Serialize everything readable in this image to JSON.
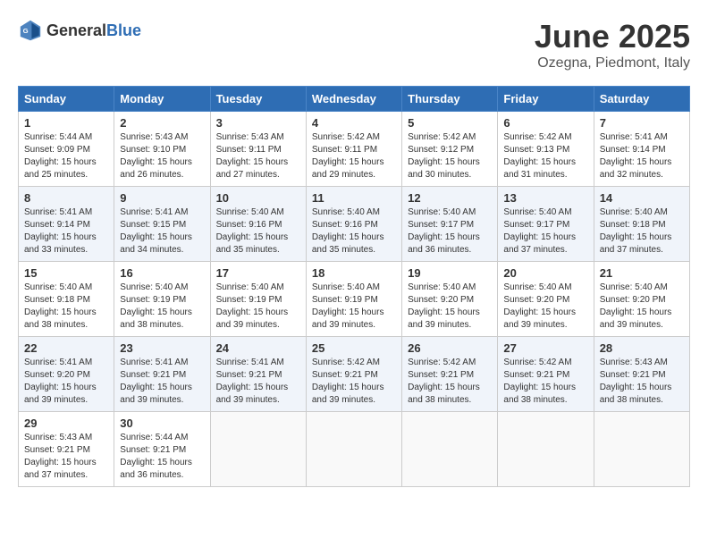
{
  "header": {
    "logo_general": "General",
    "logo_blue": "Blue",
    "month": "June 2025",
    "location": "Ozegna, Piedmont, Italy"
  },
  "days_of_week": [
    "Sunday",
    "Monday",
    "Tuesday",
    "Wednesday",
    "Thursday",
    "Friday",
    "Saturday"
  ],
  "weeks": [
    [
      {
        "day": "1",
        "info": "Sunrise: 5:44 AM\nSunset: 9:09 PM\nDaylight: 15 hours\nand 25 minutes."
      },
      {
        "day": "2",
        "info": "Sunrise: 5:43 AM\nSunset: 9:10 PM\nDaylight: 15 hours\nand 26 minutes."
      },
      {
        "day": "3",
        "info": "Sunrise: 5:43 AM\nSunset: 9:11 PM\nDaylight: 15 hours\nand 27 minutes."
      },
      {
        "day": "4",
        "info": "Sunrise: 5:42 AM\nSunset: 9:11 PM\nDaylight: 15 hours\nand 29 minutes."
      },
      {
        "day": "5",
        "info": "Sunrise: 5:42 AM\nSunset: 9:12 PM\nDaylight: 15 hours\nand 30 minutes."
      },
      {
        "day": "6",
        "info": "Sunrise: 5:42 AM\nSunset: 9:13 PM\nDaylight: 15 hours\nand 31 minutes."
      },
      {
        "day": "7",
        "info": "Sunrise: 5:41 AM\nSunset: 9:14 PM\nDaylight: 15 hours\nand 32 minutes."
      }
    ],
    [
      {
        "day": "8",
        "info": "Sunrise: 5:41 AM\nSunset: 9:14 PM\nDaylight: 15 hours\nand 33 minutes."
      },
      {
        "day": "9",
        "info": "Sunrise: 5:41 AM\nSunset: 9:15 PM\nDaylight: 15 hours\nand 34 minutes."
      },
      {
        "day": "10",
        "info": "Sunrise: 5:40 AM\nSunset: 9:16 PM\nDaylight: 15 hours\nand 35 minutes."
      },
      {
        "day": "11",
        "info": "Sunrise: 5:40 AM\nSunset: 9:16 PM\nDaylight: 15 hours\nand 35 minutes."
      },
      {
        "day": "12",
        "info": "Sunrise: 5:40 AM\nSunset: 9:17 PM\nDaylight: 15 hours\nand 36 minutes."
      },
      {
        "day": "13",
        "info": "Sunrise: 5:40 AM\nSunset: 9:17 PM\nDaylight: 15 hours\nand 37 minutes."
      },
      {
        "day": "14",
        "info": "Sunrise: 5:40 AM\nSunset: 9:18 PM\nDaylight: 15 hours\nand 37 minutes."
      }
    ],
    [
      {
        "day": "15",
        "info": "Sunrise: 5:40 AM\nSunset: 9:18 PM\nDaylight: 15 hours\nand 38 minutes."
      },
      {
        "day": "16",
        "info": "Sunrise: 5:40 AM\nSunset: 9:19 PM\nDaylight: 15 hours\nand 38 minutes."
      },
      {
        "day": "17",
        "info": "Sunrise: 5:40 AM\nSunset: 9:19 PM\nDaylight: 15 hours\nand 39 minutes."
      },
      {
        "day": "18",
        "info": "Sunrise: 5:40 AM\nSunset: 9:19 PM\nDaylight: 15 hours\nand 39 minutes."
      },
      {
        "day": "19",
        "info": "Sunrise: 5:40 AM\nSunset: 9:20 PM\nDaylight: 15 hours\nand 39 minutes."
      },
      {
        "day": "20",
        "info": "Sunrise: 5:40 AM\nSunset: 9:20 PM\nDaylight: 15 hours\nand 39 minutes."
      },
      {
        "day": "21",
        "info": "Sunrise: 5:40 AM\nSunset: 9:20 PM\nDaylight: 15 hours\nand 39 minutes."
      }
    ],
    [
      {
        "day": "22",
        "info": "Sunrise: 5:41 AM\nSunset: 9:20 PM\nDaylight: 15 hours\nand 39 minutes."
      },
      {
        "day": "23",
        "info": "Sunrise: 5:41 AM\nSunset: 9:21 PM\nDaylight: 15 hours\nand 39 minutes."
      },
      {
        "day": "24",
        "info": "Sunrise: 5:41 AM\nSunset: 9:21 PM\nDaylight: 15 hours\nand 39 minutes."
      },
      {
        "day": "25",
        "info": "Sunrise: 5:42 AM\nSunset: 9:21 PM\nDaylight: 15 hours\nand 39 minutes."
      },
      {
        "day": "26",
        "info": "Sunrise: 5:42 AM\nSunset: 9:21 PM\nDaylight: 15 hours\nand 38 minutes."
      },
      {
        "day": "27",
        "info": "Sunrise: 5:42 AM\nSunset: 9:21 PM\nDaylight: 15 hours\nand 38 minutes."
      },
      {
        "day": "28",
        "info": "Sunrise: 5:43 AM\nSunset: 9:21 PM\nDaylight: 15 hours\nand 38 minutes."
      }
    ],
    [
      {
        "day": "29",
        "info": "Sunrise: 5:43 AM\nSunset: 9:21 PM\nDaylight: 15 hours\nand 37 minutes."
      },
      {
        "day": "30",
        "info": "Sunrise: 5:44 AM\nSunset: 9:21 PM\nDaylight: 15 hours\nand 36 minutes."
      },
      {
        "day": "",
        "info": ""
      },
      {
        "day": "",
        "info": ""
      },
      {
        "day": "",
        "info": ""
      },
      {
        "day": "",
        "info": ""
      },
      {
        "day": "",
        "info": ""
      }
    ]
  ]
}
